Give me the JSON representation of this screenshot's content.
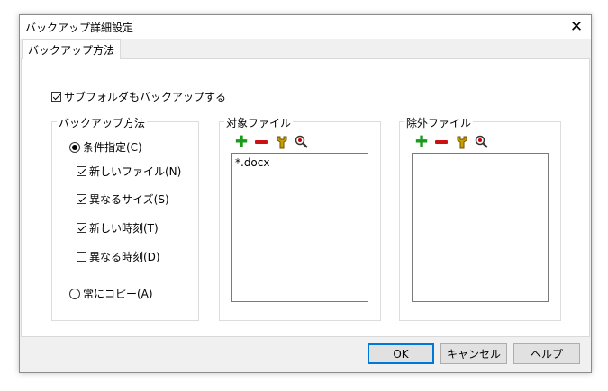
{
  "window": {
    "title": "バックアップ詳細設定"
  },
  "tab": {
    "label": "バックアップ方法"
  },
  "subfolder": {
    "label": "サブフォルダもバックアップする",
    "checked": true
  },
  "method_group": {
    "label": "バックアップ方法",
    "conditional": {
      "label": "条件指定(C)",
      "selected": true
    },
    "options": [
      {
        "label": "新しいファイル(N)",
        "checked": true
      },
      {
        "label": "異なるサイズ(S)",
        "checked": true
      },
      {
        "label": "新しい時刻(T)",
        "checked": true
      },
      {
        "label": "異なる時刻(D)",
        "checked": false
      }
    ],
    "always": {
      "label": "常にコピー(A)",
      "selected": false
    }
  },
  "target_group": {
    "label": "対象ファイル",
    "items": [
      "*.docx"
    ]
  },
  "exclude_group": {
    "label": "除外ファイル",
    "items": []
  },
  "icons": [
    "plus-icon",
    "minus-icon",
    "wrench-icon",
    "magnifier-icon"
  ],
  "buttons": {
    "ok": "OK",
    "cancel": "キャンセル",
    "help": "ヘルプ"
  },
  "colors": {
    "plus": "#1a9a1a",
    "minus": "#cc1111",
    "default_button_border": "#0078d7"
  }
}
